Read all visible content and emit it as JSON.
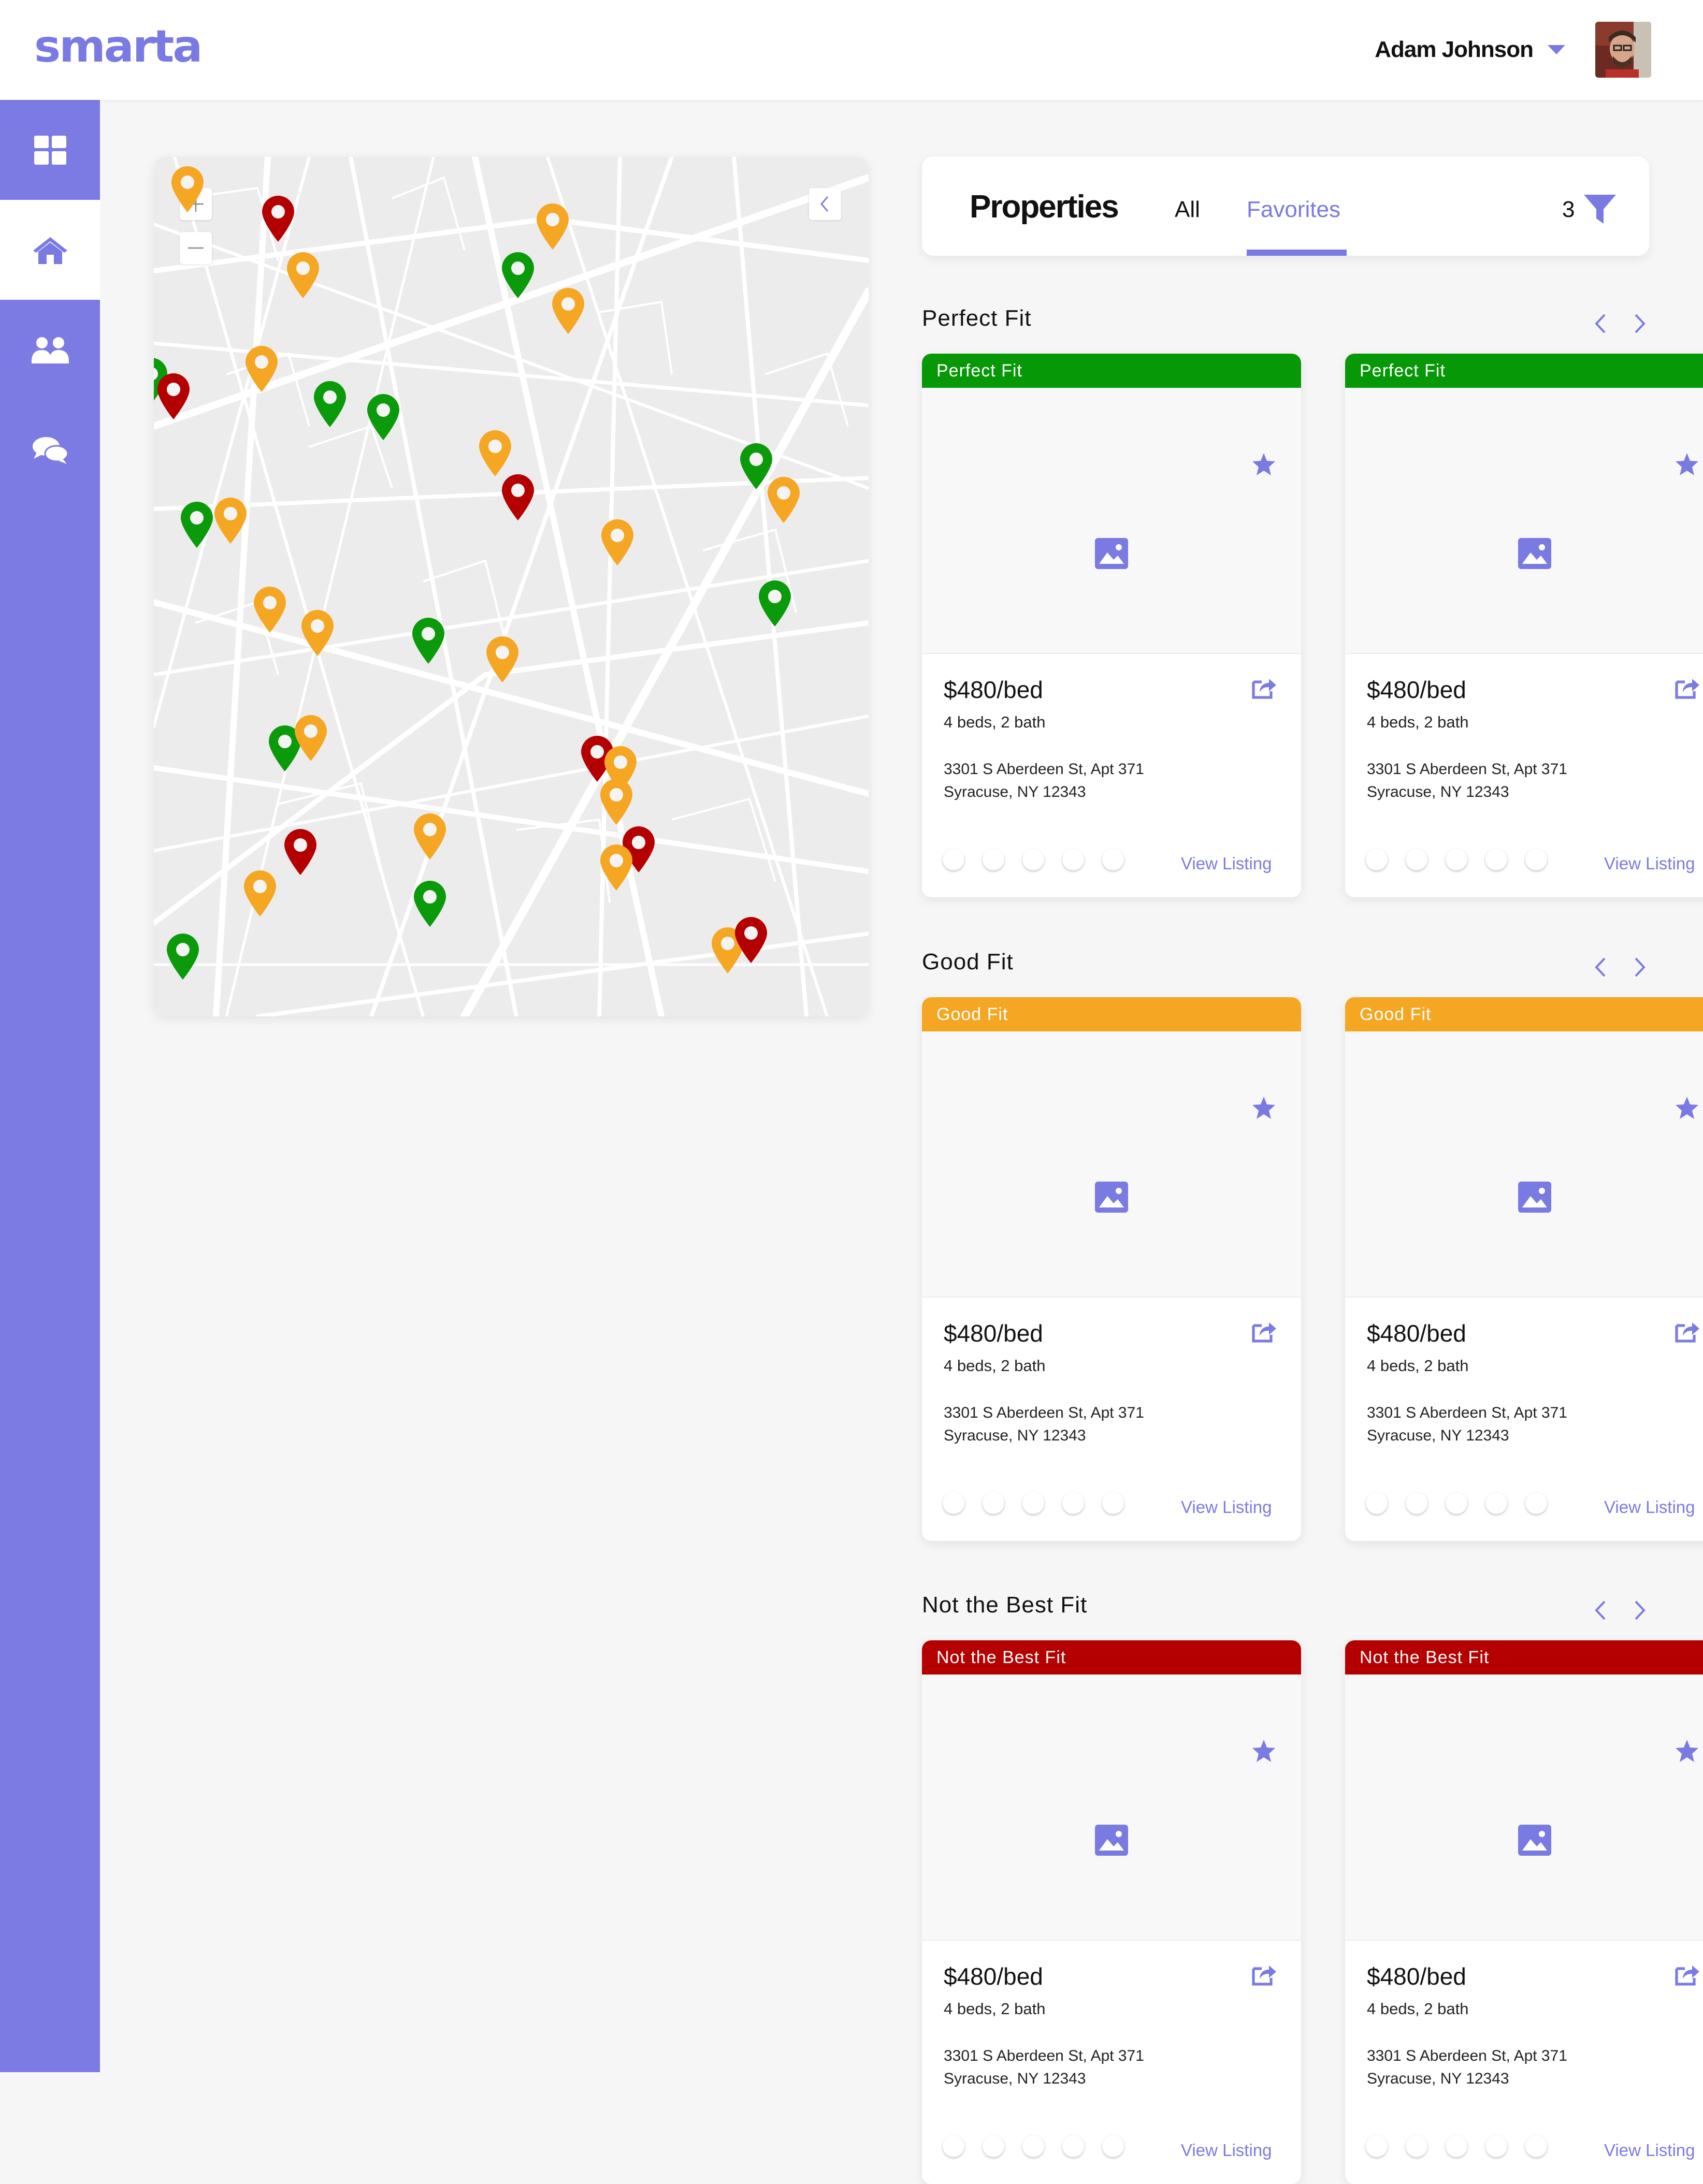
{
  "app": {
    "logo": "smarta"
  },
  "user": {
    "name": "Adam Johnson"
  },
  "sidebar": {
    "items": [
      {
        "icon": "dashboard-icon",
        "active": false
      },
      {
        "icon": "home-icon",
        "active": true
      },
      {
        "icon": "users-icon",
        "active": false
      },
      {
        "icon": "chat-icon",
        "active": false
      }
    ]
  },
  "map": {
    "pin_colors": {
      "green": "#0a9a0a",
      "orange": "#f5a623",
      "red": "#b40000"
    },
    "controls": {
      "zoom_in": "+",
      "zoom_out": "—",
      "collapse": "chevron-left-icon"
    }
  },
  "properties": {
    "title": "Properties",
    "tabs": [
      {
        "label": "All",
        "active": false
      },
      {
        "label": "Favorites",
        "active": true
      }
    ],
    "filter_count": "3"
  },
  "sections": [
    {
      "title": "Perfect Fit",
      "color": "#079807",
      "cards": [
        {
          "badge": "Perfect Fit",
          "price": "$480/bed",
          "beds": "4 beds, 2 bath",
          "address1": "3301 S Aberdeen St, Apt 371",
          "address2": "Syracuse, NY 12343",
          "link": "View Listing"
        },
        {
          "badge": "Perfect Fit",
          "price": "$480/bed",
          "beds": "4 beds, 2 bath",
          "address1": "3301 S Aberdeen St, Apt 371",
          "address2": "Syracuse, NY 12343",
          "link": "View Listing"
        }
      ]
    },
    {
      "title": "Good Fit",
      "color": "#f5a623",
      "cards": [
        {
          "badge": "Good Fit",
          "price": "$480/bed",
          "beds": "4 beds, 2 bath",
          "address1": "3301 S Aberdeen St, Apt 371",
          "address2": "Syracuse, NY 12343",
          "link": "View Listing"
        },
        {
          "badge": "Good Fit",
          "price": "$480/bed",
          "beds": "4 beds, 2 bath",
          "address1": "3301 S Aberdeen St, Apt 371",
          "address2": "Syracuse, NY 12343",
          "link": "View Listing"
        }
      ]
    },
    {
      "title": "Not the Best Fit",
      "color": "#b40000",
      "cards": [
        {
          "badge": "Not the Best Fit",
          "price": "$480/bed",
          "beds": "4 beds, 2 bath",
          "address1": "3301 S Aberdeen St, Apt 371",
          "address2": "Syracuse, NY 12343",
          "link": "View Listing"
        },
        {
          "badge": "Not the Best Fit",
          "price": "$480/bed",
          "beds": "4 beds, 2 bath",
          "address1": "3301 S Aberdeen St, Apt 371",
          "address2": "Syracuse, NY 12343",
          "link": "View Listing"
        }
      ]
    }
  ],
  "colors": {
    "accent": "#7a7ae3",
    "sidebar": "#7b7be3"
  }
}
